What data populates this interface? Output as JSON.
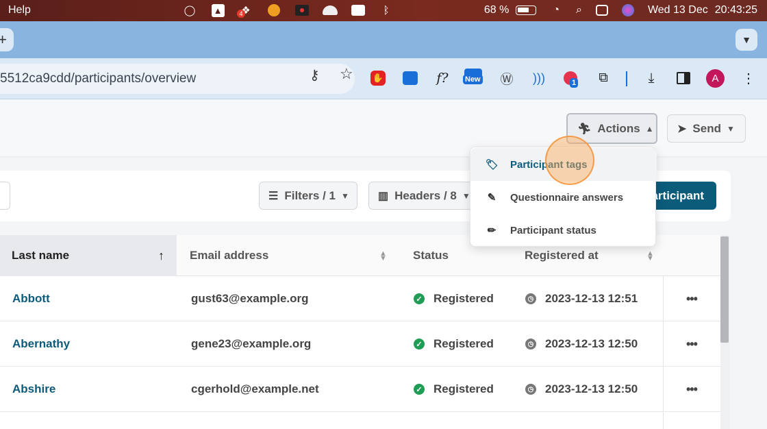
{
  "menubar": {
    "app_menu": "Help",
    "battery_percent": "68 %",
    "date": "Wed 13 Dec",
    "time": "20:43:25",
    "dropbox_badge": "4"
  },
  "browser": {
    "url": "5512ca9cdd/participants/overview",
    "new_tab_symbol": "+",
    "ext_new_badge": "New",
    "ext_count_badge": "1",
    "ext_f_label": "f?",
    "avatar_letter": "A"
  },
  "header": {
    "actions_label": "Actions",
    "send_label": "Send"
  },
  "actions_menu": {
    "items": [
      {
        "label": "Participant tags",
        "icon": "tag-icon"
      },
      {
        "label": "Questionnaire answers",
        "icon": "edit-icon"
      },
      {
        "label": "Participant status",
        "icon": "pencil-icon"
      }
    ]
  },
  "filter_bar": {
    "filters_label": "Filters / 1",
    "headers_label": "Headers / 8",
    "add_participant_label": "Add participant"
  },
  "table": {
    "columns": [
      "Last name",
      "Email address",
      "Status",
      "Registered at"
    ],
    "rows": [
      {
        "last_name": "Abbott",
        "email": "gust63@example.org",
        "status": "Registered",
        "registered_at": "2023-12-13 12:51"
      },
      {
        "last_name": "Abernathy",
        "email": "gene23@example.org",
        "status": "Registered",
        "registered_at": "2023-12-13 12:50"
      },
      {
        "last_name": "Abshire",
        "email": "cgerhold@example.net",
        "status": "Registered",
        "registered_at": "2023-12-13 12:50"
      }
    ],
    "more_symbol": "•••"
  },
  "colors": {
    "brand": "#0b5b7a",
    "success": "#1f9d55",
    "menubar": "#6b2a22"
  }
}
